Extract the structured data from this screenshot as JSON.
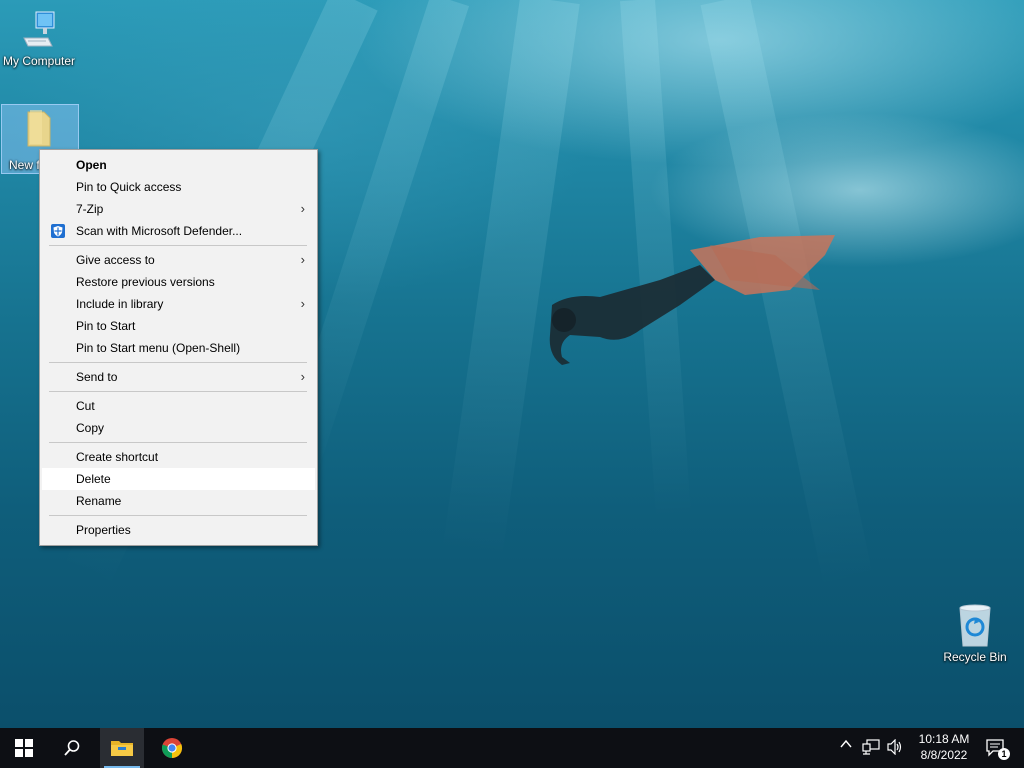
{
  "desktop": {
    "icons": {
      "my_computer": "My Computer",
      "new_folder_partial": "New f",
      "recycle_bin": "Recycle Bin"
    }
  },
  "context_menu": {
    "items": [
      {
        "label": "Open",
        "bold": true
      },
      {
        "label": "Pin to Quick access"
      },
      {
        "label": "7-Zip",
        "submenu": true
      },
      {
        "label": "Scan with Microsoft Defender...",
        "icon": "defender-shield-icon"
      },
      {
        "label": "Give access to",
        "submenu": true
      },
      {
        "label": "Restore previous versions"
      },
      {
        "label": "Include in library",
        "submenu": true
      },
      {
        "label": "Pin to Start"
      },
      {
        "label": "Pin to Start menu (Open-Shell)"
      },
      {
        "label": "Send to",
        "submenu": true
      },
      {
        "label": "Cut"
      },
      {
        "label": "Copy"
      },
      {
        "label": "Create shortcut"
      },
      {
        "label": "Delete",
        "highlighted": true
      },
      {
        "label": "Rename"
      },
      {
        "label": "Properties"
      }
    ],
    "submenu_arrow": "›"
  },
  "taskbar": {
    "buttons": [
      "start-icon",
      "search-icon",
      "file-explorer-icon",
      "chrome-icon"
    ],
    "tray": {
      "chevron": "^",
      "time": "10:18 AM",
      "date": "8/8/2022",
      "notification_count": "1"
    }
  },
  "colors": {
    "taskbar_bg": "#0d0f14",
    "menu_bg": "#f2f2f2",
    "selection_blue": "#99ccff",
    "active_indicator": "#76b9ed"
  }
}
